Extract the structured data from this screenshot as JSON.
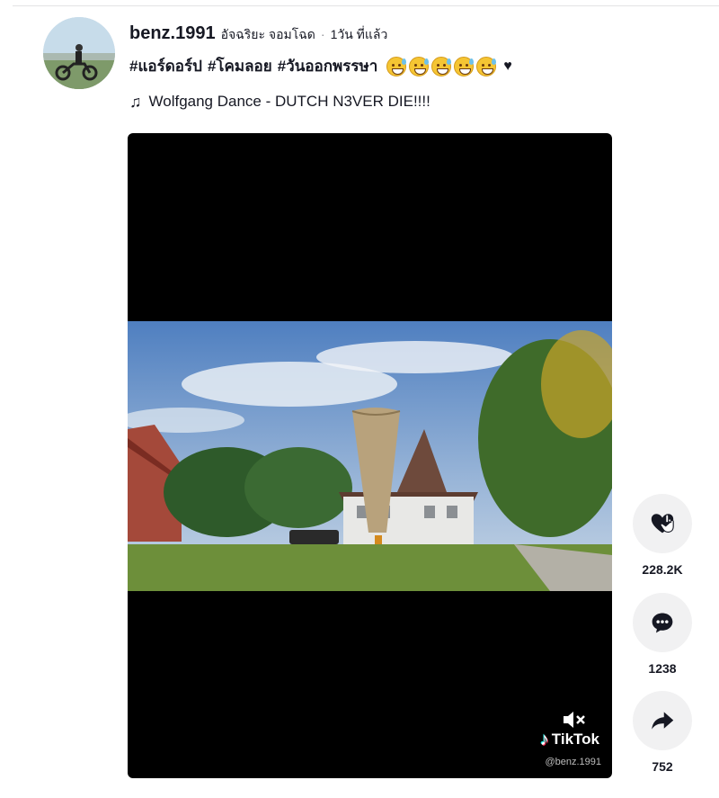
{
  "post": {
    "username": "benz.1991",
    "nickname": "อัจฉริยะ จอมโฉด",
    "separator": "·",
    "time": "1วัน ที่แล้ว",
    "hashtags": [
      "#แอร์ดอร์ป",
      "#โคมลอย",
      "#วันออกพรรษา"
    ],
    "emoji_count": 5,
    "trailing_symbol": "♥"
  },
  "music": {
    "icon": "music-note-icon",
    "symbol": "♫",
    "title": "Wolfgang Dance - DUTCH N3VER DIE!!!!"
  },
  "video": {
    "watermark_brand": "TikTok",
    "watermark_handle": "@benz.1991",
    "muted": true
  },
  "actions": {
    "likes": "228.2K",
    "comments": "1238",
    "shares": "752"
  },
  "colors": {
    "text": "#161823",
    "action_bg": "#f1f1f2",
    "video_bg": "#000000"
  }
}
